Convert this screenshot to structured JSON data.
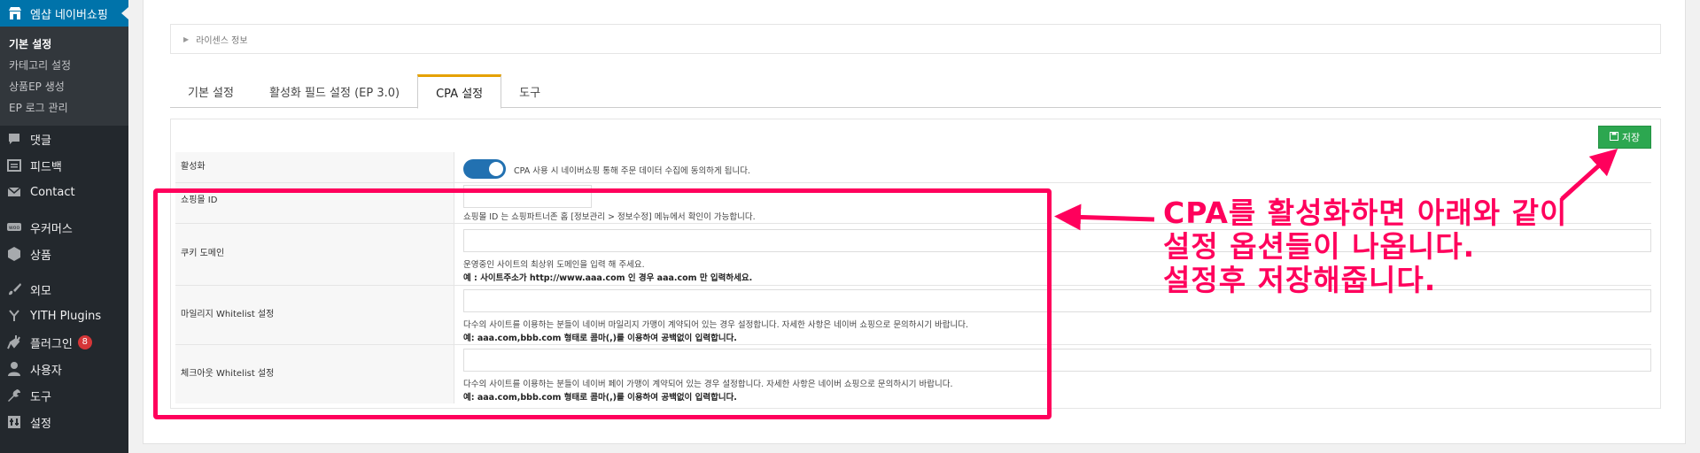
{
  "sidebar": {
    "header": "엠샵 네이버쇼핑",
    "submenu": [
      "기본 설정",
      "카테고리 설정",
      "상품EP 생성",
      "EP 로그 관리"
    ],
    "items": [
      {
        "label": "댓글",
        "icon": "comment-icon"
      },
      {
        "label": "피드백",
        "icon": "feedback-icon"
      },
      {
        "label": "Contact",
        "icon": "mail-icon"
      },
      {
        "label": "우커머스",
        "icon": "woo-icon"
      },
      {
        "label": "상품",
        "icon": "box-icon"
      },
      {
        "label": "외모",
        "icon": "brush-icon"
      },
      {
        "label": "YITH Plugins",
        "icon": "yith-icon"
      },
      {
        "label": "플러그인",
        "icon": "plugin-icon",
        "badge": "8"
      },
      {
        "label": "사용자",
        "icon": "user-icon"
      },
      {
        "label": "도구",
        "icon": "wrench-icon"
      },
      {
        "label": "설정",
        "icon": "settings-icon"
      }
    ]
  },
  "license": {
    "label": "라이센스 정보"
  },
  "tabs": [
    "기본 설정",
    "활성화 필드 설정 (EP 3.0)",
    "CPA 설정",
    "도구"
  ],
  "save_label": "저장",
  "rows": {
    "activate": {
      "label": "활성화",
      "text": "CPA 사용 시 네이버쇼핑 통해 주문 데이터 수집에 동의하게 됩니다."
    },
    "shop_id": {
      "label": "쇼핑몰 ID",
      "hint": "쇼핑몰 ID 는 쇼핑파트너존 홈 [정보관리 > 정보수정] 메뉴에서 확인이 가능합니다."
    },
    "cookie": {
      "label": "쿠키 도메인",
      "hint1": "운영중인 사이트의 최상위 도메인을 입력 해 주세요.",
      "hint2": "예 : 사이트주소가 http://www.aaa.com 인 경우 aaa.com 만 입력하세요."
    },
    "mileage": {
      "label": "마일리지 Whitelist 설정",
      "hint1": "다수의 사이트를 이용하는 분들이 네이버 마일리지 가맹이 계약되어 있는 경우 설정합니다. 자세한 사항은 네이버 쇼핑으로 문의하시기 바랍니다.",
      "hint2": "예: aaa.com,bbb.com 형태로 콤마(,)를 이용하여 공백없이 입력합니다."
    },
    "checkout": {
      "label": "체크아웃 Whitelist 설정",
      "hint1": "다수의 사이트를 이용하는 분들이 네이버 페이 가맹이 계약되어 있는 경우 설정합니다. 자세한 사항은 네이버 쇼핑으로 문의하시기 바랍니다.",
      "hint2": "예: aaa.com,bbb.com 형태로 콤마(,)를 이용하여 공백없이 입력합니다."
    }
  },
  "annotation": {
    "line1": "CPA를 활성화하면 아래와 같이",
    "line2": "설정 옵션들이 나옵니다.",
    "line3": "설정후 저장해줍니다.",
    "color": "#ff005c"
  }
}
